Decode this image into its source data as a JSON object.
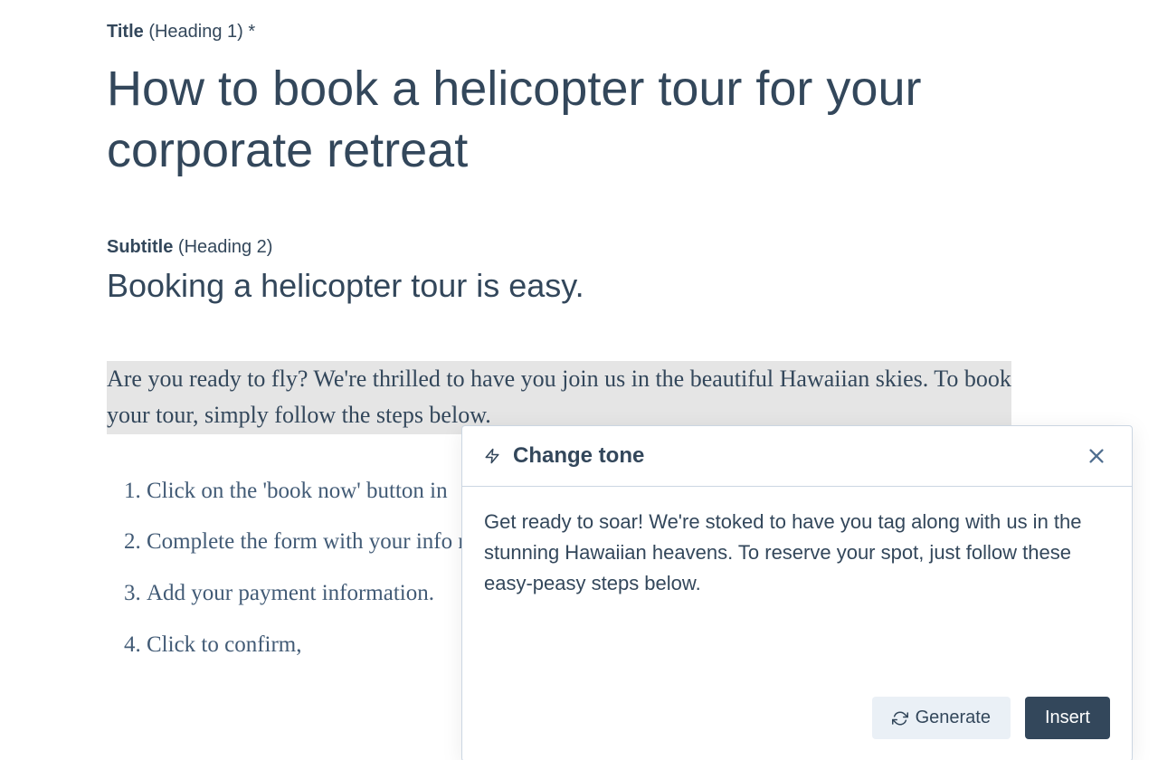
{
  "labels": {
    "title_label": "Title",
    "title_paren": "(Heading 1)",
    "title_asterisk": "*",
    "subtitle_label": "Subtitle",
    "subtitle_paren": "(Heading 2)"
  },
  "content": {
    "title": "How to book a helicopter tour for your corporate retreat",
    "subtitle": "Booking a helicopter tour is easy.",
    "selected_paragraph": "Are you ready to fly? We're thrilled to have you join us in the beautiful Hawaiian skies. To book your tour, simply follow the steps below.",
    "steps": [
      "Click on the 'book now' button in",
      "Complete the form with your info members' names.",
      "Add your payment information.",
      "Click to confirm,"
    ]
  },
  "panel": {
    "title": "Change tone",
    "suggestion": "Get ready to soar! We're stoked to have you tag along with us in the stunning Hawaiian heavens. To reserve your spot, just follow these easy-peasy steps below.",
    "generate_label": "Generate",
    "insert_label": "Insert"
  }
}
